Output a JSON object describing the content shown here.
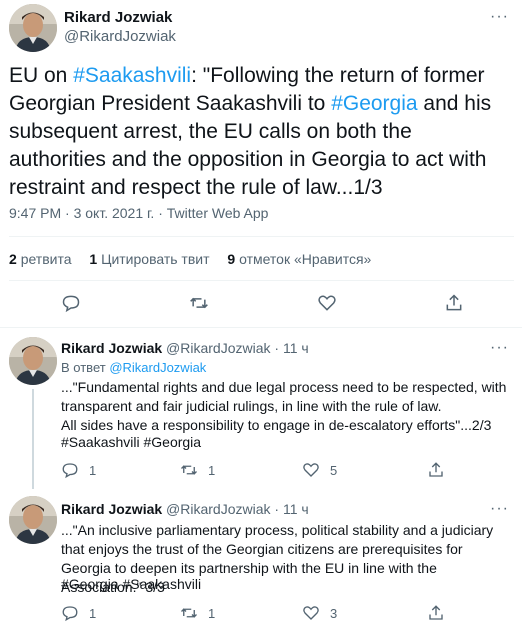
{
  "main_tweet": {
    "author_name": "Rikard Jozwiak",
    "author_handle": "@RikardJozwiak",
    "text_prefix": "EU on ",
    "hashtag1": "#Saakashvili",
    "text_mid": ": \"Following the return of former Georgian President Saakashvili to ",
    "hashtag2": "#Georgia",
    "text_suffix": " and his subsequent arrest, the EU calls on both the authorities and the opposition in Georgia to act with restraint and respect the rule of law...1/3",
    "time": "9:47 PM",
    "sep": " · ",
    "date": "3 окт. 2021 г.",
    "source": "Twitter Web App",
    "more_label": "···"
  },
  "stats": {
    "retweets_count": "2",
    "retweets_label": "ретвита",
    "quotes_count": "1",
    "quotes_label": "Цитировать твит",
    "likes_count": "9",
    "likes_label": "отметок «Нравится»"
  },
  "replies": [
    {
      "author_name": "Rikard Jozwiak",
      "author_handle": "@RikardJozwiak",
      "time_ago": "· 11 ч",
      "reply_to_prefix": "В ответ ",
      "reply_to_handle": "@RikardJozwiak",
      "text": "...\"Fundamental rights and due legal process need to be respected, with transparent and fair judicial rulings, in line with the rule of law.\nAll sides have a responsibility to engage in de-escalatory efforts\"...2/3",
      "hashtags": "#Saakashvili #Georgia",
      "reply_count": "1",
      "retweet_count": "1",
      "like_count": "5",
      "more_label": "···"
    },
    {
      "author_name": "Rikard Jozwiak",
      "author_handle": "@RikardJozwiak",
      "time_ago": "· 11 ч",
      "text": "...\"An inclusive parliamentary process, political stability and a judiciary that enjoys the trust of the Georgian citizens are prerequisites for Georgia to deepen its partnership with the EU in line with the Association.\" 3/3",
      "hashtags": "#Georgia #Saakashvili",
      "reply_count": "1",
      "retweet_count": "1",
      "like_count": "3",
      "more_label": "···"
    }
  ]
}
